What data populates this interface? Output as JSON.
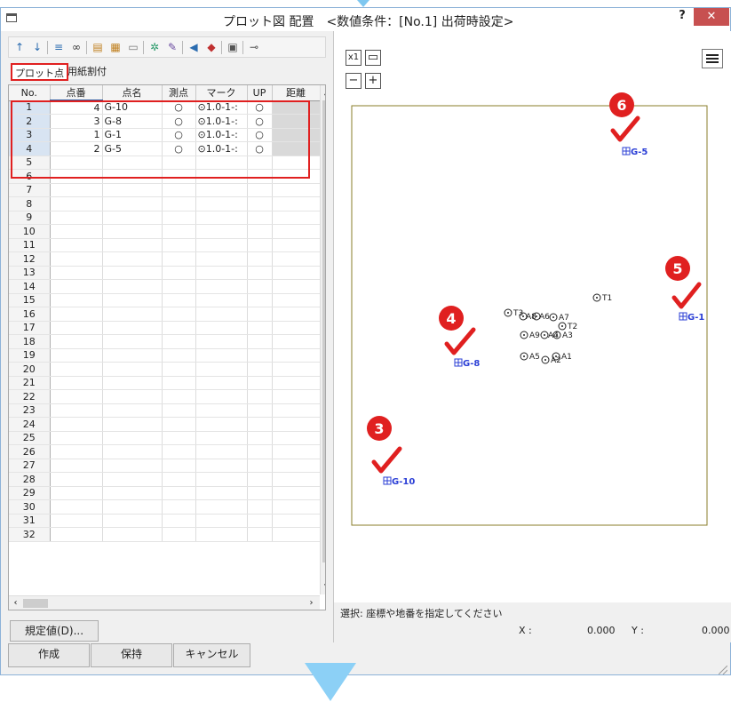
{
  "window": {
    "title": "プロット図 配置　<数値条件：[No.1] 出荷時設定>",
    "help_label": "?",
    "close_label": "✕"
  },
  "toolbar": {
    "icons": [
      "move-up-icon",
      "move-down-icon",
      "list-icon",
      "binoculars-icon",
      "insert-point-icon",
      "copy-point-icon",
      "edit-icon",
      "settings-icon",
      "text-icon",
      "speaker-icon",
      "speaker-settings-icon",
      "print-icon",
      "pin-icon"
    ]
  },
  "tabs": {
    "plot_points": "プロット点",
    "paper_layout": "用紙割付"
  },
  "grid": {
    "headers": [
      "No.",
      "点番",
      "点名",
      "測点",
      "マーク",
      "UP",
      "距離"
    ],
    "rows": [
      [
        "1",
        "4",
        "G-10",
        "○",
        "⊙1.0-1-:",
        "○",
        ""
      ],
      [
        "2",
        "3",
        "G-8",
        "○",
        "⊙1.0-1-:",
        "○",
        ""
      ],
      [
        "3",
        "1",
        "G-1",
        "○",
        "⊙1.0-1-:",
        "○",
        ""
      ],
      [
        "4",
        "2",
        "G-5",
        "○",
        "⊙1.0-1-:",
        "○",
        ""
      ]
    ],
    "empty_row_numbers": [
      "5",
      "6",
      "7",
      "8",
      "9",
      "10",
      "11",
      "12",
      "13",
      "14",
      "15",
      "16",
      "17",
      "18",
      "19",
      "20",
      "21",
      "22",
      "23",
      "24",
      "25",
      "26",
      "27",
      "28",
      "29",
      "30",
      "31",
      "32"
    ]
  },
  "buttons": {
    "defaults": "規定値(D)...",
    "create": "作成",
    "hold": "保持",
    "cancel": "キャンセル"
  },
  "zoom": {
    "x1_label": "x1",
    "minus_label": "−",
    "plus_label": "+"
  },
  "plot": {
    "frame_color": "#8a7d2a",
    "mark_color": "#2b3fd6",
    "points": [
      {
        "label": "G-10",
        "type": "plot"
      },
      {
        "label": "G-8",
        "type": "plot"
      },
      {
        "label": "G-1",
        "type": "plot"
      },
      {
        "label": "G-5",
        "type": "plot"
      }
    ],
    "survey_labels": [
      "T1",
      "T2",
      "A1",
      "A2",
      "A3",
      "A4",
      "A5",
      "A6",
      "A7",
      "A8",
      "A9",
      "T3"
    ],
    "badges": [
      "3",
      "4",
      "5",
      "6"
    ],
    "badge_color": "#e02020"
  },
  "status": {
    "message": "選択: 座標や地番を指定してください",
    "x_label": "X :",
    "x_value": "0.000",
    "y_label": "Y :",
    "y_value": "0.000"
  }
}
